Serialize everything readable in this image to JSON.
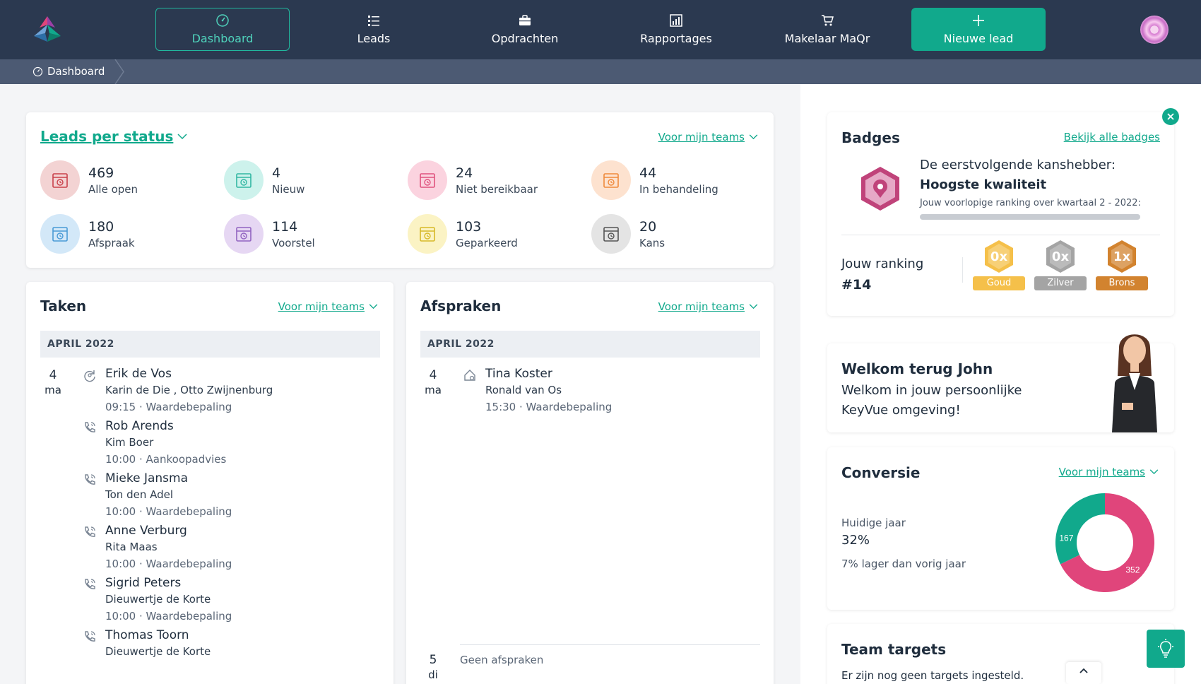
{
  "nav": {
    "items": [
      {
        "label": "Dashboard",
        "icon": "dashboard-icon"
      },
      {
        "label": "Leads",
        "icon": "list-icon"
      },
      {
        "label": "Opdrachten",
        "icon": "briefcase-icon"
      },
      {
        "label": "Rapportages",
        "icon": "report-chart-icon"
      },
      {
        "label": "Makelaar MaQr",
        "icon": "cart-icon"
      },
      {
        "label": "Nieuwe lead",
        "icon": "plus-icon"
      }
    ]
  },
  "breadcrumb": {
    "label": "Dashboard"
  },
  "leads": {
    "title": "Leads per status",
    "filter": "Voor mijn teams",
    "items": [
      {
        "count": "469",
        "label": "Alle open",
        "bg": "#f3d3d3",
        "color": "#c9414b"
      },
      {
        "count": "4",
        "label": "Nieuw",
        "bg": "#cdf2ec",
        "color": "#31b7a2"
      },
      {
        "count": "24",
        "label": "Niet bereikbaar",
        "bg": "#fbd3df",
        "color": "#e0527e"
      },
      {
        "count": "44",
        "label": "In behandeling",
        "bg": "#fde2cf",
        "color": "#f08a3c"
      },
      {
        "count": "180",
        "label": "Afspraak",
        "bg": "#d3e8f8",
        "color": "#4a9ad6"
      },
      {
        "count": "114",
        "label": "Voorstel",
        "bg": "#e6d7f3",
        "color": "#9264c1"
      },
      {
        "count": "103",
        "label": "Geparkeerd",
        "bg": "#fbf3c4",
        "color": "#d7b928"
      },
      {
        "count": "20",
        "label": "Kans",
        "bg": "#e4e4e4",
        "color": "#555555"
      }
    ]
  },
  "taken": {
    "title": "Taken",
    "filter": "Voor mijn teams",
    "month": "APRIL 2022",
    "day": "4",
    "dayname": "ma",
    "tasks": [
      {
        "name": "Erik de Vos",
        "sub": "Karin de Die , Otto Zwijnenburg",
        "time": "09:15 · Waardebepaling",
        "icon": "refresh-icon"
      },
      {
        "name": "Rob Arends",
        "sub": "Kim Boer",
        "time": "10:00 · Aankoopadvies",
        "icon": "phone-icon"
      },
      {
        "name": "Mieke Jansma",
        "sub": "Ton den Adel",
        "time": "10:00 · Waardebepaling",
        "icon": "phone-icon"
      },
      {
        "name": "Anne Verburg",
        "sub": "Rita Maas",
        "time": "10:00 · Waardebepaling",
        "icon": "phone-icon"
      },
      {
        "name": "Sigrid Peters",
        "sub": "Dieuwertje de Korte",
        "time": "10:00 · Waardebepaling",
        "icon": "phone-icon"
      },
      {
        "name": "Thomas Toorn",
        "sub": "Dieuwertje de Korte",
        "time": "",
        "icon": "phone-icon"
      }
    ]
  },
  "afspraken": {
    "title": "Afspraken",
    "filter": "Voor mijn teams",
    "month": "APRIL 2022",
    "day": "4",
    "dayname": "ma",
    "appt": {
      "name": "Tina Koster",
      "sub": "Ronald van Os",
      "time": "15:30 · Waardebepaling",
      "icon": "house-icon"
    },
    "day2": "5",
    "dayname2": "di",
    "empty": "Geen afspraken"
  },
  "badges": {
    "title": "Badges",
    "link": "Bekijk alle badges",
    "next_label": "De eerstvolgende kanshebber:",
    "next_name": "Hoogste kwaliteit",
    "ranking_text": "Jouw voorlopige ranking over kwartaal 2 - 2022:",
    "ranking_label": "Jouw ranking",
    "ranking_value": "#14",
    "medals": [
      {
        "count": "0x",
        "label": "Goud",
        "color": "#f5c04a"
      },
      {
        "count": "0x",
        "label": "Zilver",
        "color": "#a4a4a4"
      },
      {
        "count": "1x",
        "label": "Brons",
        "color": "#d2832f"
      }
    ]
  },
  "welcome": {
    "title": "Welkom terug John",
    "text": "Welkom in jouw persoonlijke KeyVue omgeving!"
  },
  "conversie": {
    "title": "Conversie",
    "filter": "Voor mijn teams",
    "year_label": "Huidige jaar",
    "pct": "32%",
    "compare": "7% lager dan vorig jaar",
    "val_a": 167,
    "val_b": 352,
    "color_a": "#11a98c",
    "color_b": "#e0457b"
  },
  "targets": {
    "title": "Team targets",
    "text": "Er zijn nog geen targets ingesteld."
  },
  "colors": {
    "accent": "#11a98c",
    "nav": "#2b3950",
    "breadcrumb": "#4c5a73"
  }
}
